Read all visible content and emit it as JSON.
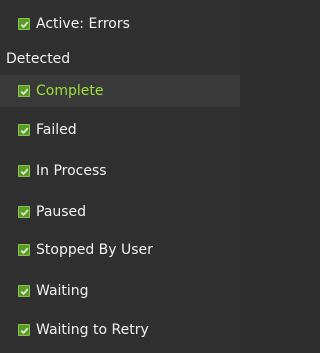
{
  "filter_menu": {
    "header": {
      "line1": "Active: Errors",
      "line2": "Detected"
    },
    "items": [
      {
        "label": "Complete",
        "checked": true,
        "selected": true
      },
      {
        "label": "Failed",
        "checked": true
      },
      {
        "label": "In Process",
        "checked": true
      },
      {
        "label": "Paused",
        "checked": true
      },
      {
        "label": "Stopped By User",
        "checked": true
      },
      {
        "label": "Waiting",
        "checked": true
      },
      {
        "label": "Waiting to Retry",
        "checked": true
      }
    ],
    "colors": {
      "background": "#303030",
      "text": "#f2f2f2",
      "selected_text": "#9be23a",
      "checkbox": "#5a9e24"
    }
  }
}
